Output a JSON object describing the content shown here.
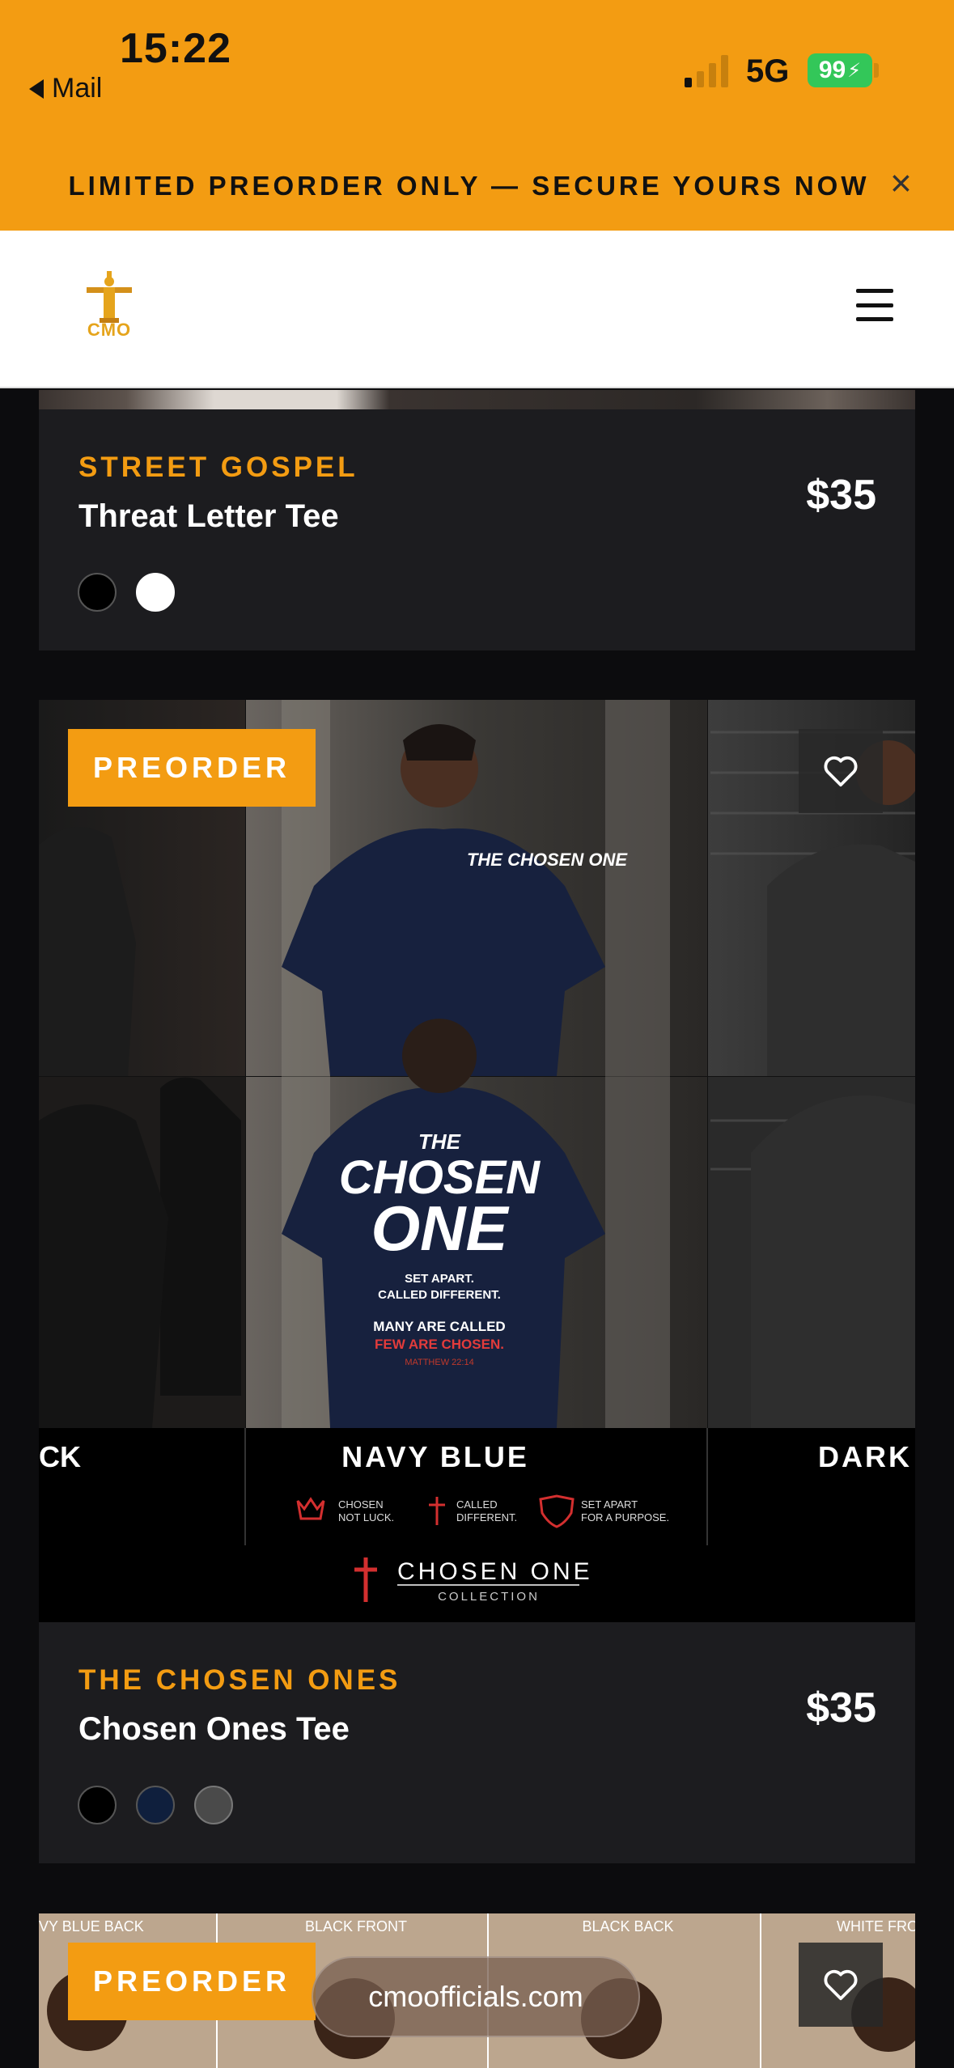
{
  "status_bar": {
    "time": "15:22",
    "back_label": "Mail",
    "network": "5G",
    "battery": "99"
  },
  "promo": {
    "text": "LIMITED PREORDER ONLY — SECURE YOURS NOW",
    "close": "×"
  },
  "header": {
    "logo_text": "CMO"
  },
  "products": [
    {
      "collection": "STREET GOSPEL",
      "name": "Threat Letter Tee",
      "price": "$35",
      "swatches": [
        "#000000",
        "#ffffff"
      ]
    },
    {
      "badge": "PREORDER",
      "collection": "THE CHOSEN ONES",
      "name": "Chosen Ones Tee",
      "price": "$35",
      "swatches": [
        "#000000",
        "#0f1f3d",
        "#4a4a4a"
      ],
      "image": {
        "left_panel_label": "CK",
        "center_panel_label": "NAVY BLUE",
        "right_panel_label": "DARK",
        "shirt_front": "THE CHOSEN ONE",
        "shirt_back_title_1": "THE",
        "shirt_back_title_2": "CHOSEN",
        "shirt_back_title_3": "ONE",
        "shirt_back_line_1": "SET APART.",
        "shirt_back_line_2": "CALLED DIFFERENT.",
        "shirt_back_line_3": "MANY ARE CALLED",
        "shirt_back_line_4": "FEW ARE CHOSEN.",
        "shirt_back_verse": "MATTHEW 22:14",
        "features": [
          {
            "line1": "CHOSEN",
            "line2": "NOT LUCK."
          },
          {
            "line1": "CALLED",
            "line2": "DIFFERENT."
          },
          {
            "line1": "SET APART",
            "line2": "FOR A PURPOSE."
          }
        ],
        "collection_title": "CHOSEN ONE",
        "collection_sub": "COLLECTION"
      }
    },
    {
      "badge": "PREORDER",
      "image_labels": [
        "VY BLUE BACK",
        "BLACK FRONT",
        "BLACK BACK",
        "WHITE FRO"
      ]
    }
  ],
  "url_bar": {
    "domain": "cmoofficials.com"
  }
}
